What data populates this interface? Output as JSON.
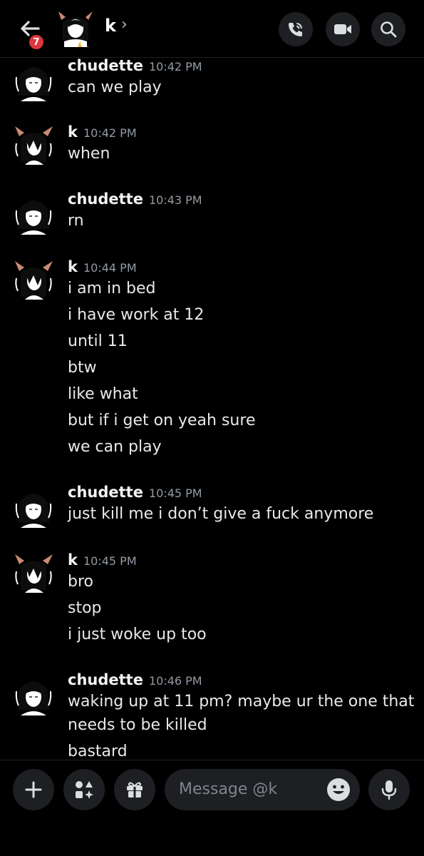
{
  "header": {
    "unread_count": "7",
    "channel_name": "k",
    "chevron": "›",
    "icons": [
      "back-arrow-icon",
      "phone-icon",
      "video-icon",
      "search-icon"
    ]
  },
  "messages": [
    {
      "author": "chudette",
      "time": "10:42 PM",
      "lines": [
        "can we play"
      ]
    },
    {
      "author": "k",
      "time": "10:42 PM",
      "lines": [
        "when"
      ]
    },
    {
      "author": "chudette",
      "time": "10:43 PM",
      "lines": [
        "rn"
      ]
    },
    {
      "author": "k",
      "time": "10:44 PM",
      "lines": [
        "i am in bed",
        "i have work at 12",
        "until 11",
        "btw",
        "like what",
        "but if i get on yeah sure",
        "we can play"
      ]
    },
    {
      "author": "chudette",
      "time": "10:45 PM",
      "lines": [
        "just kill me i don’t give a fuck anymore"
      ]
    },
    {
      "author": "k",
      "time": "10:45 PM",
      "lines": [
        "bro",
        "stop",
        "i just woke up too"
      ]
    },
    {
      "author": "chudette",
      "time": "10:46 PM",
      "lines": [
        "waking up at 11 pm? maybe ur the one that",
        "needs to be killed",
        "bastard"
      ]
    }
  ],
  "composer": {
    "placeholder": "Message @k",
    "icons": [
      "plus-icon",
      "apps-icon",
      "gift-icon",
      "emoji-icon",
      "mic-icon"
    ]
  }
}
